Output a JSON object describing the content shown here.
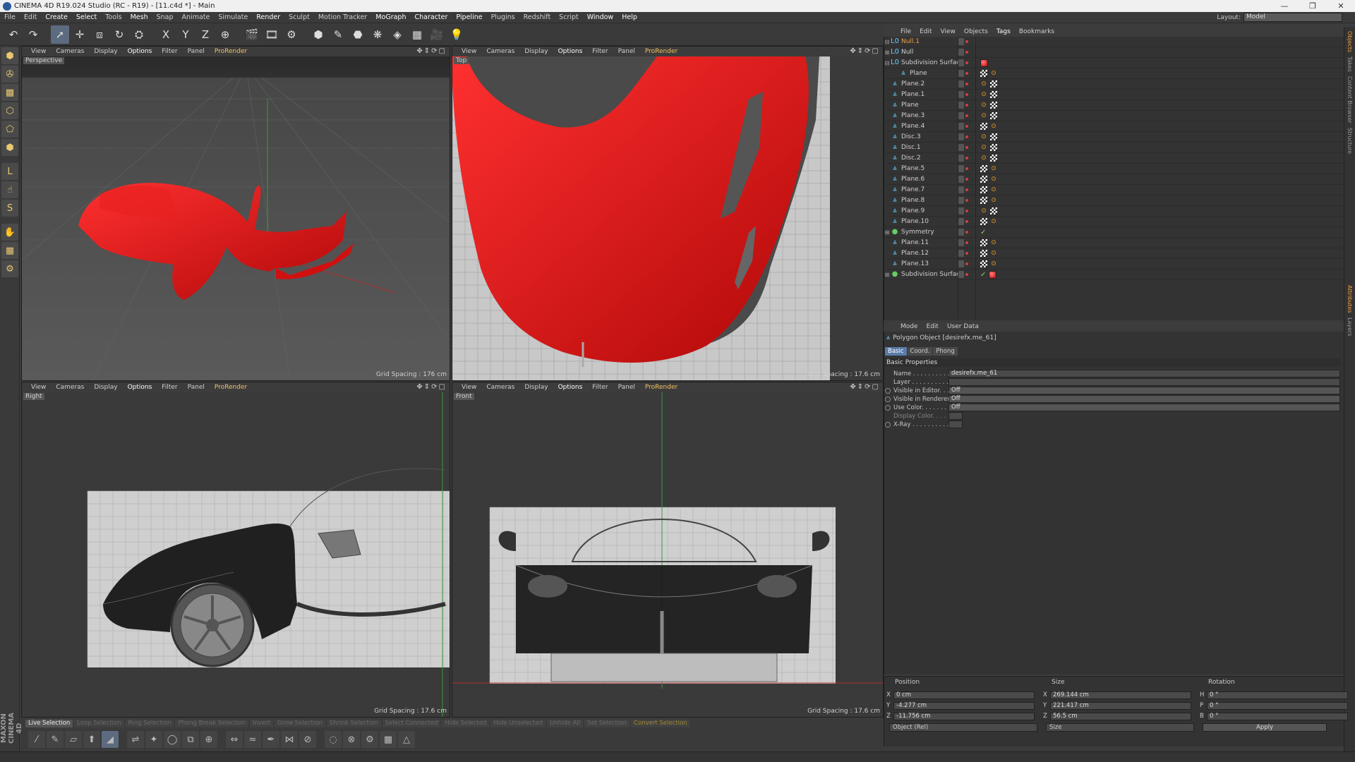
{
  "window": {
    "title": "CINEMA 4D R19.024 Studio (RC - R19) - [11.c4d *] - Main"
  },
  "menu": [
    "File",
    "Edit",
    "Create",
    "Select",
    "Tools",
    "Mesh",
    "Snap",
    "Animate",
    "Simulate",
    "Render",
    "Sculpt",
    "Motion Tracker",
    "MoGraph",
    "Character",
    "Pipeline",
    "Plugins",
    "Redshift",
    "Script",
    "Window",
    "Help"
  ],
  "menu_emph": [
    2,
    3,
    5,
    9,
    12,
    13,
    14,
    18,
    19
  ],
  "layout": {
    "label": "Layout:",
    "value": "Model"
  },
  "toolbar_icons": [
    "undo-icon",
    "redo-icon",
    "select-icon",
    "move-icon",
    "scale-icon",
    "rotate-icon",
    "recent-icon",
    "x-axis-icon",
    "y-axis-icon",
    "z-axis-icon",
    "world-coord-icon",
    "render-view-icon",
    "render-picture-viewer-icon",
    "render-settings-icon",
    "cube-icon",
    "pen-icon",
    "subdivision-icon",
    "array-icon",
    "deformer-icon",
    "floor-icon",
    "camera-icon",
    "light-icon"
  ],
  "toolbar_glyphs": [
    "↶",
    "↷",
    "➚",
    "✛",
    "⧈",
    "↻",
    "⛭",
    "X",
    "Y",
    "Z",
    "⊕",
    "🎬",
    "🎞",
    "⚙",
    "⬢",
    "✎",
    "⬣",
    "❋",
    "◈",
    "▦",
    "🎥",
    "💡"
  ],
  "left_tools": [
    "make-editable-icon",
    "texture-icon",
    "workplane-icon",
    "points-mode-icon",
    "edges-mode-icon",
    "polygons-mode-icon",
    "axis-mode-icon",
    "tweak-icon",
    "snap-icon",
    "brush-icon",
    "lock-workplane-icon",
    "grid-icon"
  ],
  "left_glyphs": [
    "⬢",
    "✇",
    "▩",
    "⬡",
    "⬠",
    "⬢",
    "L",
    "☝",
    "S",
    "✋",
    "▦",
    "⚙"
  ],
  "maxon": "MAXON CINEMA 4D",
  "viewports": [
    {
      "name": "Perspective",
      "menu": [
        "View",
        "Cameras",
        "Display",
        "Options",
        "Filter",
        "Panel",
        "ProRender"
      ],
      "grid": "Grid Spacing : 176 cm"
    },
    {
      "name": "Top",
      "menu": [
        "View",
        "Cameras",
        "Display",
        "Options",
        "Filter",
        "Panel",
        "ProRender"
      ],
      "grid": "Grid Spacing : 17.6 cm"
    },
    {
      "name": "Right",
      "menu": [
        "View",
        "Cameras",
        "Display",
        "Options",
        "Filter",
        "Panel",
        "ProRender"
      ],
      "grid": "Grid Spacing : 17.6 cm"
    },
    {
      "name": "Front",
      "menu": [
        "View",
        "Cameras",
        "Display",
        "Options",
        "Filter",
        "Panel",
        "ProRender"
      ],
      "grid": "Grid Spacing : 17.6 cm"
    }
  ],
  "viewport_nav": "✥⇕⟳▢",
  "object_manager": {
    "menu": [
      "File",
      "Edit",
      "View",
      "Objects",
      "Tags",
      "Bookmarks"
    ],
    "objects": [
      {
        "name": "Null.1",
        "icon": "null-icon",
        "glyph": "L0",
        "selected": true,
        "expand": "⊟",
        "tags": []
      },
      {
        "name": "Null",
        "icon": "null-icon",
        "glyph": "L0",
        "expand": "⊞",
        "tags": []
      },
      {
        "name": "Subdivision Surface",
        "icon": "subdivision-icon",
        "glyph": "L0",
        "expand": "⊟",
        "tags": [
          "mat"
        ]
      },
      {
        "name": "Plane",
        "icon": "polygon-icon",
        "glyph": "⩓",
        "indent": 2,
        "tags": [
          "chk",
          "phong"
        ]
      },
      {
        "name": "Plane.2",
        "icon": "polygon-icon",
        "glyph": "⩓",
        "tags": [
          "phong",
          "chk"
        ]
      },
      {
        "name": "Plane.1",
        "icon": "polygon-icon",
        "glyph": "⩓",
        "tags": [
          "phong",
          "chk"
        ]
      },
      {
        "name": "Plane",
        "icon": "polygon-icon",
        "glyph": "⩓",
        "tags": [
          "phong",
          "chk"
        ]
      },
      {
        "name": "Plane.3",
        "icon": "polygon-icon",
        "glyph": "⩓",
        "tags": [
          "phong",
          "chk"
        ]
      },
      {
        "name": "Plane.4",
        "icon": "polygon-icon",
        "glyph": "⩓",
        "tags": [
          "chk",
          "phong"
        ]
      },
      {
        "name": "Disc.3",
        "icon": "polygon-icon",
        "glyph": "⩓",
        "tags": [
          "phong",
          "chk"
        ]
      },
      {
        "name": "Disc.1",
        "icon": "polygon-icon",
        "glyph": "⩓",
        "tags": [
          "phong",
          "chk"
        ]
      },
      {
        "name": "Disc.2",
        "icon": "polygon-icon",
        "glyph": "⩓",
        "tags": [
          "phong",
          "chk"
        ]
      },
      {
        "name": "Plane.5",
        "icon": "polygon-icon",
        "glyph": "⩓",
        "tags": [
          "chk",
          "phong"
        ]
      },
      {
        "name": "Plane.6",
        "icon": "polygon-icon",
        "glyph": "⩓",
        "tags": [
          "chk",
          "phong"
        ]
      },
      {
        "name": "Plane.7",
        "icon": "polygon-icon",
        "glyph": "⩓",
        "tags": [
          "chk",
          "phong"
        ]
      },
      {
        "name": "Plane.8",
        "icon": "polygon-icon",
        "glyph": "⩓",
        "tags": [
          "chk",
          "phong"
        ]
      },
      {
        "name": "Plane.9",
        "icon": "polygon-icon",
        "glyph": "⩓",
        "tags": [
          "phong",
          "chk"
        ]
      },
      {
        "name": "Plane.10",
        "icon": "polygon-icon",
        "glyph": "⩓",
        "tags": [
          "chk",
          "phong"
        ]
      },
      {
        "name": "Symmetry",
        "icon": "symmetry-icon",
        "glyph": "●",
        "expand": "⊞",
        "tags": [
          "check"
        ]
      },
      {
        "name": "Plane.11",
        "icon": "polygon-icon",
        "glyph": "⩓",
        "tags": [
          "chk",
          "phong"
        ]
      },
      {
        "name": "Plane.12",
        "icon": "polygon-icon",
        "glyph": "⩓",
        "tags": [
          "chk",
          "phong"
        ]
      },
      {
        "name": "Plane.13",
        "icon": "polygon-icon",
        "glyph": "⩓",
        "tags": [
          "chk",
          "phong"
        ]
      },
      {
        "name": "Subdivision Surface",
        "icon": "subdivision-icon",
        "glyph": "●",
        "expand": "⊞",
        "tags": [
          "check",
          "mat"
        ]
      }
    ]
  },
  "side_tabs": [
    "Objects",
    "Takes",
    "Content Browser",
    "Structure"
  ],
  "side_tabs2": [
    "Attributes",
    "Layers"
  ],
  "attributes": {
    "menu": [
      "Mode",
      "Edit",
      "User Data"
    ],
    "title": "Polygon Object [desirefx.me_61]",
    "tabs": [
      "Basic",
      "Coord.",
      "Phong"
    ],
    "section": "Basic Properties",
    "rows": [
      {
        "label": "Name . . . . . . . . . . . .",
        "value": "desirefx.me_61"
      },
      {
        "label": "Layer . . . . . . . . . . . .",
        "value": ""
      },
      {
        "label": "Visible in Editor. . .",
        "value": "Off",
        "radio": true,
        "drop": true
      },
      {
        "label": "Visible in Renderer",
        "value": "Off",
        "radio": true,
        "drop": true
      },
      {
        "label": "Use Color. . . . . . . . .",
        "value": "Off",
        "radio": true,
        "drop": true
      },
      {
        "label": "Display Color. . . . . .",
        "value": "",
        "dim": true,
        "short": true
      },
      {
        "label": "X-Ray . . . . . . . . . . . .",
        "value": "",
        "radio": true,
        "short": true
      }
    ]
  },
  "coords": {
    "headers": [
      "Position",
      "Size",
      "Rotation"
    ],
    "position": [
      [
        "X",
        "0 cm"
      ],
      [
        "Y",
        "-4.277 cm"
      ],
      [
        "Z",
        "-11.756 cm"
      ]
    ],
    "size": [
      [
        "X",
        "269.144 cm"
      ],
      [
        "Y",
        "221.417 cm"
      ],
      [
        "Z",
        "56.5 cm"
      ]
    ],
    "rotation": [
      [
        "H",
        "0 °"
      ],
      [
        "P",
        "0 °"
      ],
      [
        "B",
        "0 °"
      ]
    ],
    "mode": "Object (Rel)",
    "size_mode": "Size",
    "apply": "Apply"
  },
  "selection_bar": [
    "Live Selection",
    "Loop Selection",
    "Ring Selection",
    "Phong Break Selection",
    "Invert",
    "Grow Selection",
    "Shrink Selection",
    "Select Connected",
    "Hide Selected",
    "Hide Unselected",
    "Unhide All",
    "Set Selection",
    "Convert Selection"
  ],
  "bottom_tools": [
    "knife-icon",
    "brush-icon",
    "plane-cut-icon",
    "extrude-icon",
    "bevel-icon",
    "bridge-icon",
    "weld-icon",
    "close-hole-icon",
    "mirror-icon",
    "magnet-icon",
    "slide-icon",
    "iron-icon",
    "polygon-pen-icon",
    "stitch-icon",
    "split-icon",
    "melt-icon",
    "dissolve-icon",
    "optimize-icon",
    "subdivide-icon",
    "triangulate-icon"
  ],
  "bottom_glyphs": [
    "⁄",
    "✎",
    "▱",
    "⬆",
    "◢",
    "⇌",
    "✦",
    "◯",
    "⧉",
    "⊕",
    "⇔",
    "≈",
    "✒",
    "⋈",
    "⊘",
    "◌",
    "⊗",
    "⚙",
    "▦",
    "△"
  ]
}
